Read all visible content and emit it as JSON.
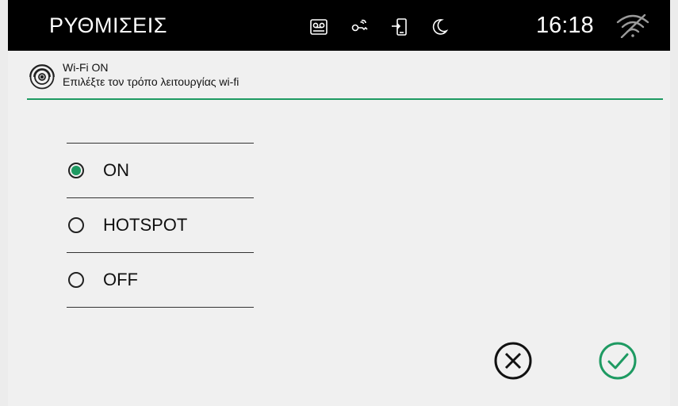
{
  "topbar": {
    "title": "ΡΥΘΜΙΣΕΙΣ",
    "time": "16:18",
    "icons": [
      "voicemail-icon",
      "key-icon",
      "door-entry-icon",
      "moon-icon",
      "wifi-off-icon"
    ]
  },
  "header": {
    "title": "Wi-Fi ON",
    "subtitle": "Επιλέξτε τον τρόπο λειτουργίας wi-fi",
    "icon": "wifi-signal-icon"
  },
  "options": [
    {
      "label": "ON",
      "selected": true
    },
    {
      "label": "HOTSPOT",
      "selected": false
    },
    {
      "label": "OFF",
      "selected": false
    }
  ],
  "actions": {
    "cancel_icon": "cancel-x-icon",
    "confirm_icon": "confirm-check-icon"
  },
  "colors": {
    "accent": "#1e9a62",
    "topbar_bg": "#000000",
    "background": "#f0f0f0"
  }
}
